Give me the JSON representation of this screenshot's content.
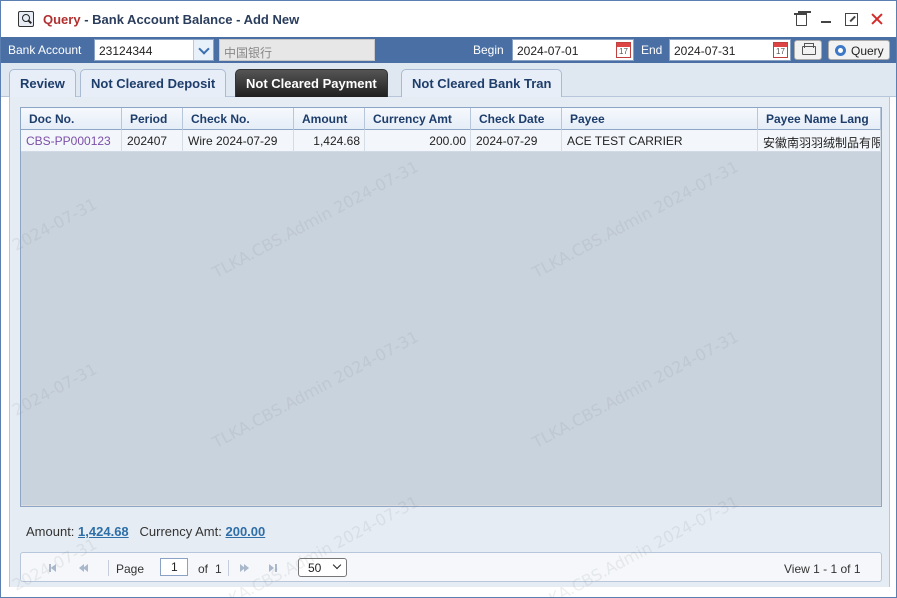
{
  "window": {
    "title_prefix": "Query",
    "title_separator": " - ",
    "title": "Bank Account Balance - Add New"
  },
  "toolbar": {
    "bank_account_label": "Bank Account",
    "bank_account_value": "23124344",
    "bank_name": "中国银行",
    "begin_label": "Begin",
    "begin_value": "2024-07-01",
    "end_label": "End",
    "end_value": "2024-07-31",
    "query_label": "Query"
  },
  "tabs": [
    {
      "label": "Review",
      "active": false
    },
    {
      "label": "Not Cleared Deposit",
      "active": false
    },
    {
      "label": "Not Cleared Payment",
      "active": true
    },
    {
      "label": "Not Cleared Bank Tran",
      "active": false
    }
  ],
  "grid": {
    "columns": [
      "Doc No.",
      "Period",
      "Check No.",
      "Amount",
      "Currency Amt",
      "Check Date",
      "Payee",
      "Payee Name Lang"
    ],
    "rows": [
      [
        "CBS-PP000123",
        "202407",
        "Wire 2024-07-29",
        "1,424.68",
        "200.00",
        "2024-07-29",
        "ACE TEST CARRIER",
        "安徽南羽羽绒制品有限"
      ]
    ]
  },
  "totals": {
    "amount_label": "Amount:",
    "amount_value": "1,424.68",
    "currency_label": "Currency Amt:",
    "currency_value": "200.00"
  },
  "pager": {
    "page_label": "Page",
    "page_value": "1",
    "of_label": "of",
    "total_pages": "1",
    "page_size": "50",
    "view_text": "View 1 - 1 of 1"
  },
  "watermark": {
    "user_text": "TLKA.CBS.Admin 2024-07-31",
    "date_text": "2024-07-31"
  },
  "colors": {
    "toolbar_bg": "#4a6fa5",
    "active_tab_bg": "#2a2a2a",
    "link_purple": "#7b4fa8",
    "total_link": "#2e6fa8"
  }
}
